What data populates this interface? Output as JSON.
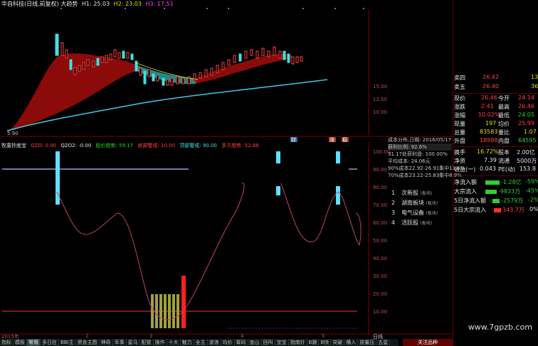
{
  "header": {
    "title": "华自科技(日线,前复权) 大趋势",
    "h1": "H1: 25.03",
    "h2": "H2: 23.03",
    "h3": "H3: 17.51"
  },
  "price_axis": [
    "15.00",
    "12.50",
    "10.00"
  ],
  "low_label": "5.90",
  "indicator": {
    "name": "牧童抄底宝",
    "qzo": "QZO: 0.00",
    "qzo2": "QZO2: -0.00",
    "jiajia": "股价趋势: 59.17",
    "dibu": "底部警戒: 10.00",
    "dingbu": "顶部警戒: 90.00",
    "duofang": "多方趋势: 52.88",
    "axis": [
      "100.00",
      "90.00",
      "80.00",
      "70.00",
      "60.00",
      "50.00",
      "40.00",
      "30.00",
      "20.00",
      "10.00"
    ]
  },
  "markers": [
    "财",
    "涨",
    "稳"
  ],
  "cost_info": [
    "成本分布,日期: 2016/05/17",
    "获利比例: 92.6%",
    "31.17处获利盘: 100.00%",
    "平均成本: 24.06元",
    "90%成本22.92-26.91集中13.6%",
    "70%成本23.22-25.83集中8.9%"
  ],
  "menu": [
    {
      "n": "1",
      "label": "次新股",
      "tag": "(板块)"
    },
    {
      "n": "2",
      "label": "湖南板块",
      "tag": "(板块)"
    },
    {
      "n": "3",
      "label": "电气设备",
      "tag": "(板块)"
    },
    {
      "n": "4",
      "label": "活跃股",
      "tag": "(板块)"
    }
  ],
  "quote_top": [
    {
      "k": "卖四",
      "v": "26.42",
      "q": "13"
    },
    {
      "k": "卖五",
      "v": "26.40",
      "q": "36"
    }
  ],
  "quote": [
    {
      "k": "现价",
      "v": "26.46",
      "k2": "今开",
      "v2": "24.14"
    },
    {
      "k": "涨跌",
      "v": "2.41",
      "k2": "最高",
      "v2": "26.46"
    },
    {
      "k": "涨幅",
      "v": "10.02%",
      "k2": "最低",
      "v2": "24.05"
    },
    {
      "k": "现量",
      "v": "197",
      "k2": "均价",
      "v2": "25.99"
    },
    {
      "k": "总量",
      "v": "83583",
      "k2": "量比",
      "v2": "1.07"
    },
    {
      "k": "外盘",
      "v": "18988",
      "k2": "内盘",
      "v2": "64595"
    },
    {
      "k": "换手",
      "v": "16.72%",
      "k2": "股本",
      "v2": "2.00亿"
    },
    {
      "k": "净资",
      "v": "7.39",
      "k2": "流通",
      "v2": "5000万"
    },
    {
      "k": "收益(一)",
      "v": "0.043",
      "k2": "PE(动)",
      "v2": "153.8"
    }
  ],
  "flows": [
    {
      "k": "净流入额",
      "v": "-1.28亿",
      "p": "-59%"
    },
    {
      "k": "大宗流入",
      "v": "-9833万",
      "p": "-45%"
    },
    {
      "k": "5日净流入额",
      "v": "-2579万",
      "p": "-2%"
    },
    {
      "k": "5日大宗流入",
      "v": "343.7万",
      "p": "0%"
    }
  ],
  "timeline": {
    "year": "2015年",
    "months": [
      "2",
      "3",
      "4",
      "5"
    ],
    "period": "日线"
  },
  "tabs": [
    "指标",
    "模板",
    "常用",
    "多日在",
    "BBI主",
    "资金主图",
    "神奇",
    "军事",
    "星马",
    "配管",
    "操作",
    "十大",
    "魅力",
    "全主",
    "波浪",
    "均价",
    "筹码",
    "金山",
    "回叫",
    "宝宝",
    "指南针",
    "B跟",
    "B快",
    "突破",
    "横入",
    "放量压",
    "五星"
  ],
  "active_tab": "常用",
  "bottom_right": "关注品种",
  "watermark": "www.7gpzb.com",
  "colors": {
    "up": "#ff4040",
    "down": "#40e0e0",
    "ma": "#40c8e8",
    "trend": "#c04070",
    "band_up": "#8b0a0a",
    "band_down": "#1a8a8a"
  }
}
